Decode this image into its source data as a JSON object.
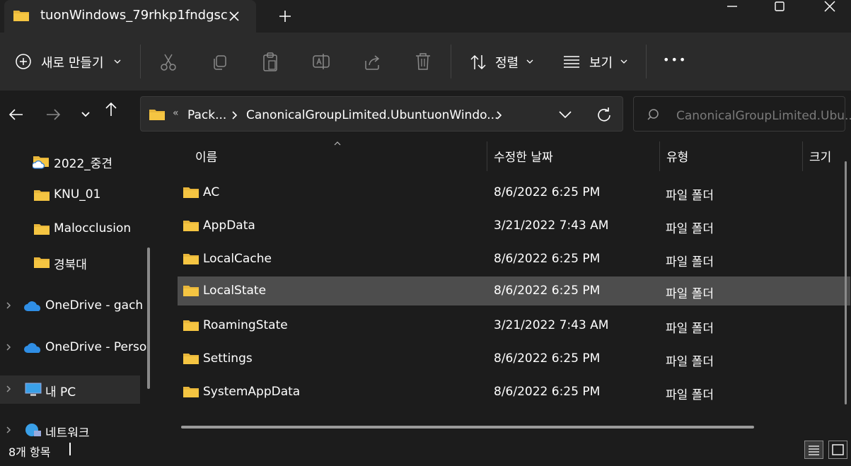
{
  "window": {
    "tab_title": "tuonWindows_79rhkp1fndgsc",
    "new_tab_symbol": "+"
  },
  "toolbar": {
    "new_label": "새로 만들기",
    "sort_label": "정렬",
    "view_label": "보기",
    "more_label": "•••"
  },
  "address": {
    "overflow": "«",
    "crumbs": [
      "Pack...",
      "CanonicalGroupLimited.UbuntuonWindo..."
    ],
    "search_placeholder": "CanonicalGroupLimited.Ubu..."
  },
  "nav": {
    "items": [
      {
        "label": "2022_중견",
        "icon": "cloud-folder-icon"
      },
      {
        "label": "KNU_01",
        "icon": "folder-icon"
      },
      {
        "label": "Malocclusion",
        "icon": "folder-icon"
      },
      {
        "label": "경북대",
        "icon": "folder-icon"
      },
      {
        "label": "OneDrive - gach",
        "icon": "onedrive-icon"
      },
      {
        "label": "OneDrive - Perso",
        "icon": "onedrive-icon"
      },
      {
        "label": "내 PC",
        "icon": "pc-icon"
      },
      {
        "label": "네트워크",
        "icon": "network-icon"
      }
    ]
  },
  "columns": {
    "name": "이름",
    "modified": "수정한 날짜",
    "type": "유형",
    "size": "크기"
  },
  "files": [
    {
      "name": "AC",
      "modified": "8/6/2022 6:25 PM",
      "type": "파일 폴더"
    },
    {
      "name": "AppData",
      "modified": "3/21/2022 7:43 AM",
      "type": "파일 폴더"
    },
    {
      "name": "LocalCache",
      "modified": "8/6/2022 6:25 PM",
      "type": "파일 폴더"
    },
    {
      "name": "LocalState",
      "modified": "8/6/2022 6:25 PM",
      "type": "파일 폴더"
    },
    {
      "name": "RoamingState",
      "modified": "3/21/2022 7:43 AM",
      "type": "파일 폴더"
    },
    {
      "name": "Settings",
      "modified": "8/6/2022 6:25 PM",
      "type": "파일 폴더"
    },
    {
      "name": "SystemAppData",
      "modified": "8/6/2022 6:25 PM",
      "type": "파일 폴더"
    }
  ],
  "status": {
    "count_text": "8개 항목"
  },
  "colors": {
    "folder": "#f5c542",
    "selected_row": "#4d4d4d",
    "background": "#1c1c1c",
    "toolbar": "#2b2b2b"
  }
}
